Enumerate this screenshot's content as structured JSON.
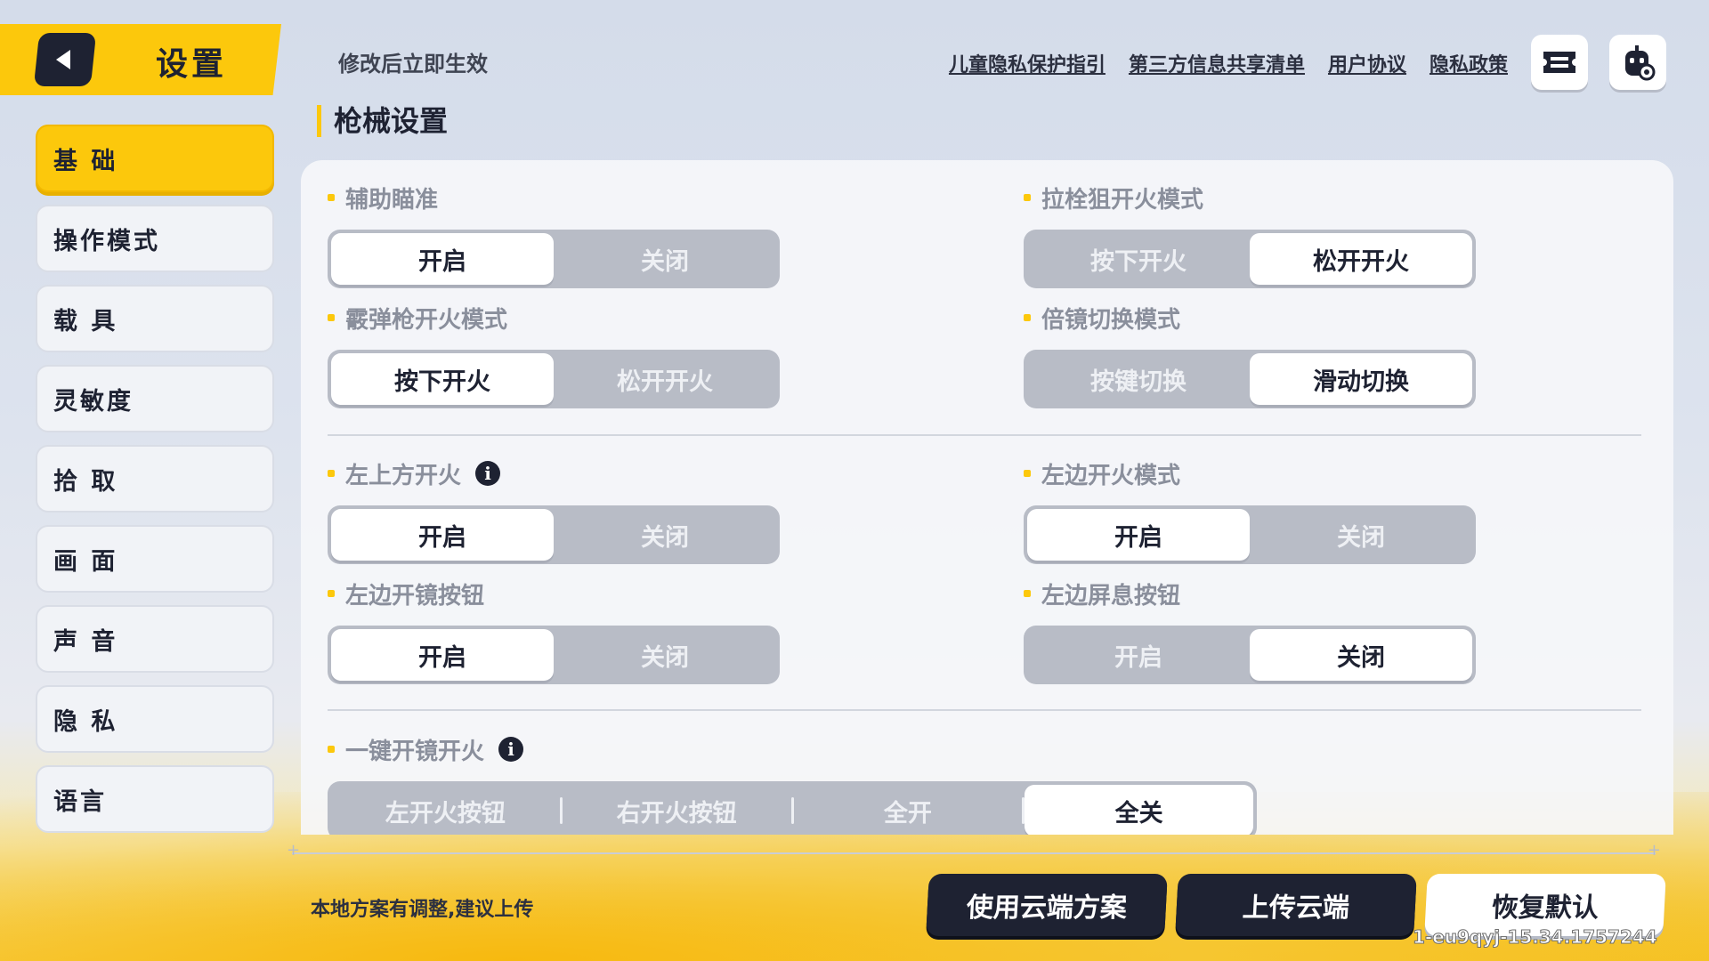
{
  "header": {
    "title": "设置",
    "hint": "修改后立即生效",
    "links": [
      "儿童隐私保护指引",
      "第三方信息共享清单",
      "用户协议",
      "隐私政策"
    ]
  },
  "sidebar": {
    "items": [
      {
        "label": "基 础",
        "active": true
      },
      {
        "label": "操作模式"
      },
      {
        "label": "载 具"
      },
      {
        "label": "灵敏度"
      },
      {
        "label": "拾 取"
      },
      {
        "label": "画 面"
      },
      {
        "label": "声 音"
      },
      {
        "label": "隐 私"
      },
      {
        "label": "语言"
      }
    ]
  },
  "section": {
    "title": "枪械设置"
  },
  "settings": {
    "aim_assist": {
      "label": "辅助瞄准",
      "options": [
        "开启",
        "关闭"
      ],
      "selected": 0
    },
    "bolt_fire": {
      "label": "拉栓狙开火模式",
      "options": [
        "按下开火",
        "松开开火"
      ],
      "selected": 1
    },
    "shotgun_fire": {
      "label": "霰弹枪开火模式",
      "options": [
        "按下开火",
        "松开开火"
      ],
      "selected": 0
    },
    "scope_switch": {
      "label": "倍镜切换模式",
      "options": [
        "按键切换",
        "滑动切换"
      ],
      "selected": 1
    },
    "upper_left_fire": {
      "label": "左上方开火",
      "options": [
        "开启",
        "关闭"
      ],
      "selected": 0
    },
    "left_fire_mode": {
      "label": "左边开火模式",
      "options": [
        "开启",
        "关闭"
      ],
      "selected": 0
    },
    "left_scope_btn": {
      "label": "左边开镜按钮",
      "options": [
        "开启",
        "关闭"
      ],
      "selected": 0
    },
    "left_breath_btn": {
      "label": "左边屏息按钮",
      "options": [
        "开启",
        "关闭"
      ],
      "selected": 1
    },
    "one_key_scope_fire": {
      "label": "一键开镜开火",
      "options": [
        "左开火按钮",
        "右开火按钮",
        "全开",
        "全关"
      ],
      "selected": 3
    }
  },
  "footer": {
    "hint": "本地方案有调整,建议上传",
    "use_cloud": "使用云端方案",
    "upload": "上传云端",
    "restore": "恢复默认",
    "version": "1-eu9qyj-15.34.1757244"
  },
  "colors": {
    "accent": "#fcc80c",
    "dark": "#1e2232",
    "toggle_bg": "#b8bcc6"
  }
}
